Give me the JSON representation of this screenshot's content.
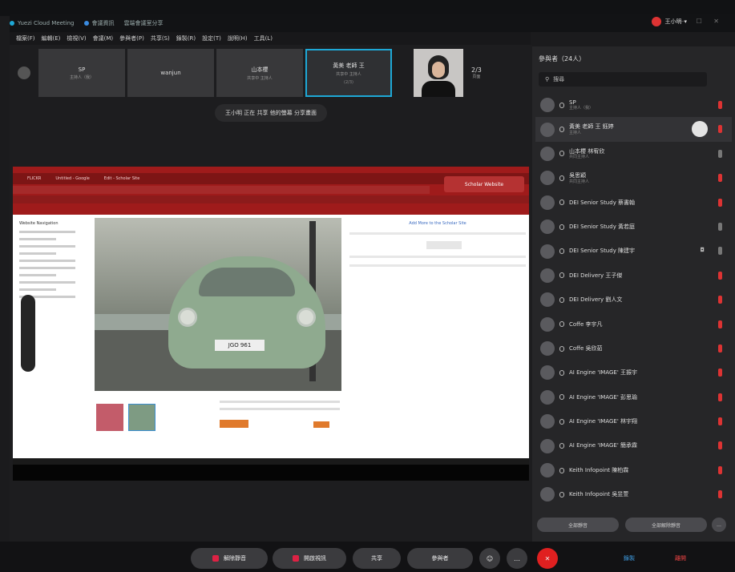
{
  "window": {
    "title": "Yuezi Cloud Meeting",
    "tab_label": "會議資訊",
    "tab_label2": "雲端會議室分享"
  },
  "topbar": {
    "user": "王小明",
    "user_arrow": "▾",
    "window_controls": "— ☐ ✕"
  },
  "menu": [
    "檔案(F)",
    "編輯(E)",
    "檢視(V)",
    "會議(M)",
    "參與者(P)",
    "共享(S)",
    "錄製(R)",
    "設定(T)",
    "說明(H)",
    "工具(L)"
  ],
  "tiles": [
    {
      "name": "SP",
      "sub": "主持人（我）"
    },
    {
      "name": "wanjun",
      "sub": ""
    },
    {
      "name": "山本櫻",
      "sub": "共享中 主持人"
    },
    {
      "name": "黃美 老師 王",
      "sub": "共享中 主持人",
      "extra": "(2/3)"
    }
  ],
  "video_more": {
    "label": "2/3",
    "sub": "頁面"
  },
  "banner": "王小明 正在 共享 他的螢幕 分享畫面",
  "share": {
    "tabs": [
      "FLICKR",
      "Untitled - Google",
      "Edit - Scholar Site"
    ],
    "brand": "Scholar Website",
    "sidebar_title": "Website Navigation",
    "plate": "JGO 961",
    "right_title": "Add More to the Scholar Site"
  },
  "panel": {
    "title": "參與者（24人）",
    "search_placeholder": "搜尋",
    "participants": [
      {
        "name": "SP",
        "sub": "主持人（我）",
        "status": "on"
      },
      {
        "name": "黃美 老師 王 鈺婷",
        "sub": "主持人",
        "status": "on",
        "highlight": true
      },
      {
        "name": "山本櫻 林宥欣",
        "sub": "共同主持人",
        "status": "off"
      },
      {
        "name": "吳思穎",
        "sub": "共同主持人",
        "status": "on"
      },
      {
        "name": "DEI Senior Study 蔡書翰",
        "sub": "",
        "status": "on"
      },
      {
        "name": "DEI Senior Study 黃若庭",
        "sub": "",
        "status": "off"
      },
      {
        "name": "DEI Senior Study 陳建宇",
        "sub": "",
        "status": "off",
        "camera": true
      },
      {
        "name": "DEI Delivery 王子傑",
        "sub": "",
        "status": "on"
      },
      {
        "name": "DEI Delivery 劉人文",
        "sub": "",
        "status": "on"
      },
      {
        "name": "Coffe 李宇凡",
        "sub": "",
        "status": "on"
      },
      {
        "name": "Coffe 吳欣茹",
        "sub": "",
        "status": "on"
      },
      {
        "name": "AI Engine 'IMAGE' 王振宇",
        "sub": "",
        "status": "on"
      },
      {
        "name": "AI Engine 'IMAGE' 彭思瑜",
        "sub": "",
        "status": "on"
      },
      {
        "name": "AI Engine 'IMAGE' 林宇翔",
        "sub": "",
        "status": "on"
      },
      {
        "name": "AI Engine 'IMAGE' 簡承霖",
        "sub": "",
        "status": "on"
      },
      {
        "name": "Keith Infopoint 陳柏霖",
        "sub": "",
        "status": "on"
      },
      {
        "name": "Keith Infopoint 吳昱萱",
        "sub": "",
        "status": "on"
      }
    ],
    "btn_mute_all": "全部靜音",
    "btn_unmute_all": "全部解除靜音",
    "btn_more": "…"
  },
  "toolbar": {
    "mute": "解除靜音",
    "video": "開啟視訊",
    "share": "共享",
    "participants": "參與者",
    "chat_icon": "☺",
    "reactions_icon": "…",
    "end_icon": "✕",
    "record": "錄製",
    "leave": "離開"
  }
}
